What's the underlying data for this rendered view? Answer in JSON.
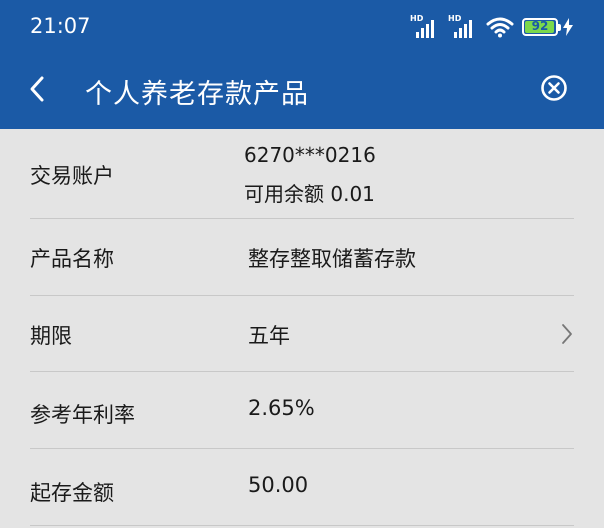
{
  "status_bar": {
    "time": "21:07",
    "signal1_label": "HD",
    "signal2_label": "HD",
    "battery": "92",
    "icons": [
      "signal-icon",
      "signal-icon",
      "wifi-icon",
      "battery-icon",
      "charging-icon"
    ]
  },
  "header": {
    "title": "个人养老存款产品",
    "back_icon": "chevron-left-icon",
    "close_icon": "close-circle-icon",
    "color": "#1b5aa6"
  },
  "rows": [
    {
      "label": "交易账户",
      "value": "6270***0216",
      "subvalue": "可用余额 0.01"
    },
    {
      "label": "产品名称",
      "value": "整存整取储蓄存款"
    },
    {
      "label": "期限",
      "value": "五年"
    },
    {
      "label": "参考年利率",
      "value": "2.65%"
    },
    {
      "label": "起存金额",
      "value": "50.00"
    }
  ]
}
